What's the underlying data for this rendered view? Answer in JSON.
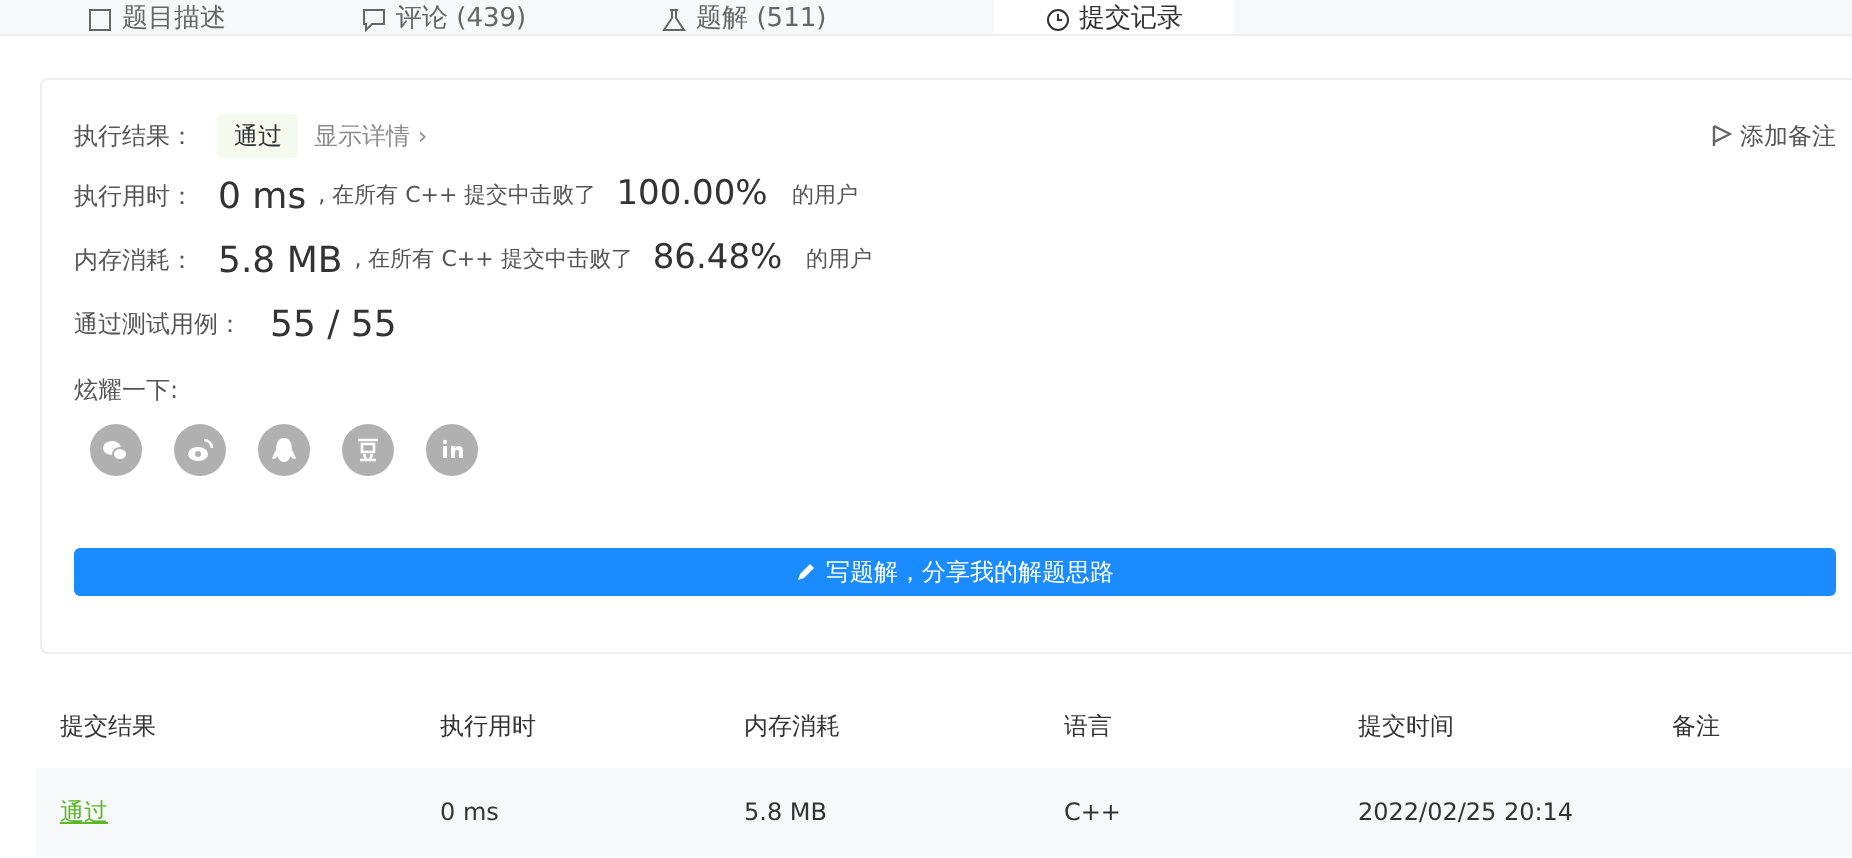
{
  "tabs": [
    {
      "label": "题目描述",
      "kind": "doc",
      "selected": false
    },
    {
      "label": "评论 (439)",
      "kind": "comment",
      "selected": false
    },
    {
      "label": "题解 (511)",
      "kind": "flask",
      "selected": false
    },
    {
      "label": "提交记录",
      "kind": "clock",
      "selected": true
    }
  ],
  "result": {
    "label": "执行结果：",
    "status": "通过",
    "details_link": "显示详情 ›",
    "note_button": "添加备注",
    "runtime": {
      "label": "执行用时：",
      "value": "0 ms",
      "text": ", 在所有 C++ 提交中击败了",
      "percent": "100.00%",
      "suffix": "的用户"
    },
    "memory": {
      "label": "内存消耗：",
      "value": "5.8 MB",
      "text": ", 在所有 C++ 提交中击败了",
      "percent": "86.48%",
      "suffix": "的用户"
    },
    "tests": {
      "label": "通过测试用例：",
      "value": "55 / 55"
    },
    "share_label": "炫耀一下:",
    "share": [
      {
        "kind": "wechat"
      },
      {
        "kind": "weibo"
      },
      {
        "kind": "qq"
      },
      {
        "kind": "douban"
      },
      {
        "kind": "linkedin"
      }
    ],
    "write_button": "写题解，分享我的解题思路"
  },
  "table": {
    "columns": [
      "提交结果",
      "执行用时",
      "内存消耗",
      "语言",
      "提交时间",
      "备注"
    ],
    "rows": [
      {
        "status": "通过",
        "runtime": "0 ms",
        "memory": "5.8 MB",
        "language": "C++",
        "time": "2022/02/25 20:14"
      }
    ]
  }
}
